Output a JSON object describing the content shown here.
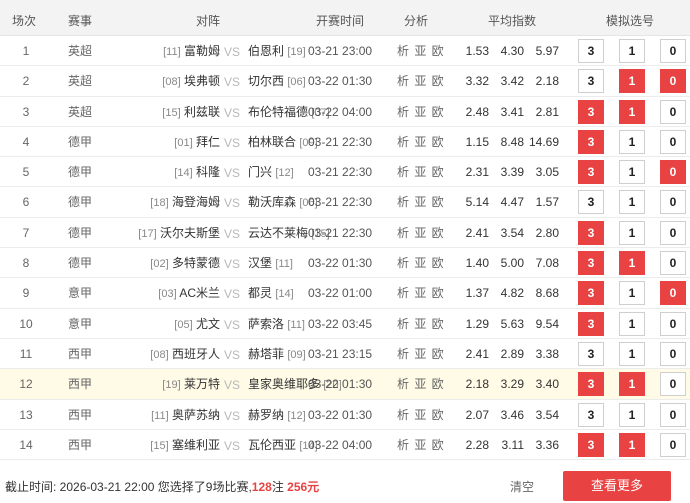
{
  "headers": {
    "index": "场次",
    "league": "赛事",
    "matchup": "对阵",
    "time": "开赛时间",
    "analysis": "分析",
    "odds": "平均指数",
    "picks": "模拟选号"
  },
  "analysis_label": "析 亚 欧",
  "vs_label": "VS",
  "pick_labels": [
    "3",
    "1",
    "0"
  ],
  "colors": {
    "accent": "#e84242",
    "highlight_row": "#fffbe6"
  },
  "matches": [
    {
      "idx": "1",
      "league": "英超",
      "home": "富勒姆",
      "home_rank": "[11]",
      "away": "伯恩利",
      "away_rank": "[19]",
      "time": "03-21 23:00",
      "odds": [
        "1.53",
        "4.30",
        "5.97"
      ],
      "picks": [
        false,
        false,
        false
      ],
      "highlight": false
    },
    {
      "idx": "2",
      "league": "英超",
      "home": "埃弗顿",
      "home_rank": "[08]",
      "away": "切尔西",
      "away_rank": "[06]",
      "time": "03-22 01:30",
      "odds": [
        "3.32",
        "3.42",
        "2.18"
      ],
      "picks": [
        false,
        true,
        true
      ],
      "highlight": false
    },
    {
      "idx": "3",
      "league": "英超",
      "home": "利兹联",
      "home_rank": "[15]",
      "away": "布伦特福德",
      "away_rank": "[07]",
      "time": "03-22 04:00",
      "odds": [
        "2.48",
        "3.41",
        "2.81"
      ],
      "picks": [
        true,
        true,
        false
      ],
      "highlight": false
    },
    {
      "idx": "4",
      "league": "德甲",
      "home": "拜仁",
      "home_rank": "[01]",
      "away": "柏林联合",
      "away_rank": "[09]",
      "time": "03-21 22:30",
      "odds": [
        "1.15",
        "8.48",
        "14.69"
      ],
      "picks": [
        true,
        false,
        false
      ],
      "highlight": false
    },
    {
      "idx": "5",
      "league": "德甲",
      "home": "科隆",
      "home_rank": "[14]",
      "away": "门兴",
      "away_rank": "[12]",
      "time": "03-21 22:30",
      "odds": [
        "2.31",
        "3.39",
        "3.05"
      ],
      "picks": [
        true,
        false,
        true
      ],
      "highlight": false
    },
    {
      "idx": "6",
      "league": "德甲",
      "home": "海登海姆",
      "home_rank": "[18]",
      "away": "勒沃库森",
      "away_rank": "[06]",
      "time": "03-21 22:30",
      "odds": [
        "5.14",
        "4.47",
        "1.57"
      ],
      "picks": [
        false,
        false,
        false
      ],
      "highlight": false
    },
    {
      "idx": "7",
      "league": "德甲",
      "home": "沃尔夫斯堡",
      "home_rank": "[17]",
      "away": "云达不莱梅",
      "away_rank": "[15]",
      "time": "03-21 22:30",
      "odds": [
        "2.41",
        "3.54",
        "2.80"
      ],
      "picks": [
        true,
        false,
        false
      ],
      "highlight": false
    },
    {
      "idx": "8",
      "league": "德甲",
      "home": "多特蒙德",
      "home_rank": "[02]",
      "away": "汉堡",
      "away_rank": "[11]",
      "time": "03-22 01:30",
      "odds": [
        "1.40",
        "5.00",
        "7.08"
      ],
      "picks": [
        true,
        true,
        false
      ],
      "highlight": false
    },
    {
      "idx": "9",
      "league": "意甲",
      "home": "AC米兰",
      "home_rank": "[03]",
      "away": "都灵",
      "away_rank": "[14]",
      "time": "03-22 01:00",
      "odds": [
        "1.37",
        "4.82",
        "8.68"
      ],
      "picks": [
        true,
        false,
        true
      ],
      "highlight": false
    },
    {
      "idx": "10",
      "league": "意甲",
      "home": "尤文",
      "home_rank": "[05]",
      "away": "萨索洛",
      "away_rank": "[11]",
      "time": "03-22 03:45",
      "odds": [
        "1.29",
        "5.63",
        "9.54"
      ],
      "picks": [
        true,
        false,
        false
      ],
      "highlight": false
    },
    {
      "idx": "11",
      "league": "西甲",
      "home": "西班牙人",
      "home_rank": "[08]",
      "away": "赫塔菲",
      "away_rank": "[09]",
      "time": "03-21 23:15",
      "odds": [
        "2.41",
        "2.89",
        "3.38"
      ],
      "picks": [
        false,
        false,
        false
      ],
      "highlight": false
    },
    {
      "idx": "12",
      "league": "西甲",
      "home": "莱万特",
      "home_rank": "[19]",
      "away": "皇家奥维耶多",
      "away_rank": "[20]",
      "time": "03-22 01:30",
      "odds": [
        "2.18",
        "3.29",
        "3.40"
      ],
      "picks": [
        true,
        true,
        false
      ],
      "highlight": true
    },
    {
      "idx": "13",
      "league": "西甲",
      "home": "奥萨苏纳",
      "home_rank": "[11]",
      "away": "赫罗纳",
      "away_rank": "[12]",
      "time": "03-22 01:30",
      "odds": [
        "2.07",
        "3.46",
        "3.54"
      ],
      "picks": [
        false,
        false,
        false
      ],
      "highlight": false
    },
    {
      "idx": "14",
      "league": "西甲",
      "home": "塞维利亚",
      "home_rank": "[15]",
      "away": "瓦伦西亚",
      "away_rank": "[14]",
      "time": "03-22 04:00",
      "odds": [
        "2.28",
        "3.11",
        "3.36"
      ],
      "picks": [
        true,
        true,
        false
      ],
      "highlight": false
    }
  ],
  "footer": {
    "deadline_label": "截止时间: ",
    "deadline_value": "2026-03-21 22:00",
    "selected_text": "您选择了9场比赛,",
    "bets": "128",
    "bets_unit": "注 ",
    "amount": "256元",
    "clear": "清空",
    "more": "查看更多"
  }
}
